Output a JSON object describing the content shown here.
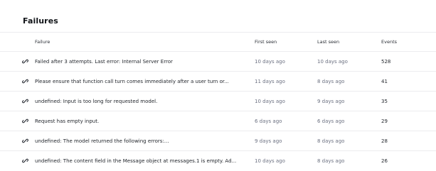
{
  "section": {
    "title": "Failures"
  },
  "table": {
    "columns": [
      "Failure",
      "First seen",
      "Last seen",
      "Events"
    ],
    "rows": [
      {
        "failure": "Failed after 3 attempts. Last error: Internal Server Error",
        "first_seen": "10 days ago",
        "last_seen": "10 days ago",
        "events": "528"
      },
      {
        "failure": "Please ensure that function call turn comes immediately after a user turn or...",
        "first_seen": "11 days ago",
        "last_seen": "8 days ago",
        "events": "41"
      },
      {
        "failure": "undefined: Input is too long for requested model.",
        "first_seen": "10 days ago",
        "last_seen": "9 days ago",
        "events": "35"
      },
      {
        "failure": "Request has empty input.",
        "first_seen": "6 days ago",
        "last_seen": "6 days ago",
        "events": "29"
      },
      {
        "failure": "undefined: The model returned the following errors:...",
        "first_seen": "9 days ago",
        "last_seen": "8 days ago",
        "events": "28"
      },
      {
        "failure": "undefined: The content field in the Message object at messages.1 is empty. Ad...",
        "first_seen": "10 days ago",
        "last_seen": "8 days ago",
        "events": "26"
      }
    ],
    "row_icon": "link-icon"
  },
  "colors": {
    "text": "#1f2329",
    "muted": "#6b7080",
    "divider": "#ececef"
  }
}
